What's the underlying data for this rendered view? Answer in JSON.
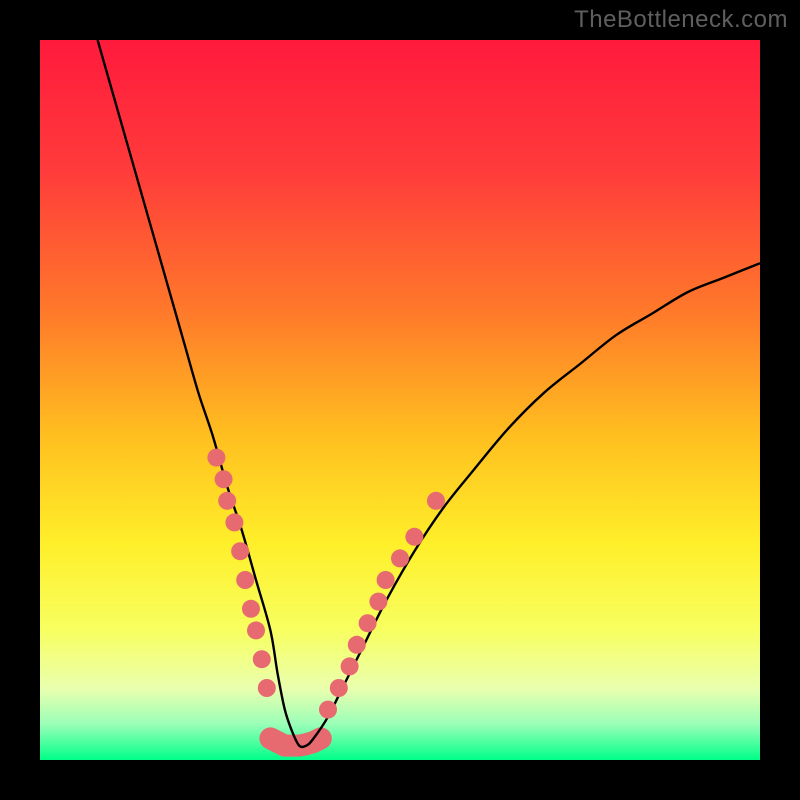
{
  "watermark": "TheBottleneck.com",
  "chart_data": {
    "type": "line",
    "title": "",
    "xlabel": "",
    "ylabel": "",
    "xlim": [
      0,
      100
    ],
    "ylim": [
      0,
      100
    ],
    "gradient_stops": [
      {
        "offset": 0,
        "color": "#ff1a3c"
      },
      {
        "offset": 18,
        "color": "#ff3b3b"
      },
      {
        "offset": 38,
        "color": "#ff7a2a"
      },
      {
        "offset": 55,
        "color": "#ffbf1f"
      },
      {
        "offset": 70,
        "color": "#ffef2a"
      },
      {
        "offset": 82,
        "color": "#f7ff60"
      },
      {
        "offset": 90,
        "color": "#eaffae"
      },
      {
        "offset": 95,
        "color": "#9bffb8"
      },
      {
        "offset": 100,
        "color": "#00ff88"
      }
    ],
    "series": [
      {
        "name": "bottleneck-curve",
        "color": "#000000",
        "x": [
          8,
          10,
          12,
          14,
          16,
          18,
          20,
          22,
          24,
          26,
          28,
          30,
          32,
          33,
          34,
          35,
          36,
          37,
          38,
          40,
          42,
          45,
          48,
          52,
          56,
          60,
          65,
          70,
          75,
          80,
          85,
          90,
          95,
          100
        ],
        "y": [
          100,
          93,
          86,
          79,
          72,
          65,
          58,
          51,
          45,
          38,
          32,
          25,
          18,
          12,
          7,
          4,
          2,
          2,
          3,
          6,
          10,
          16,
          22,
          29,
          35,
          40,
          46,
          51,
          55,
          59,
          62,
          65,
          67,
          69
        ]
      }
    ],
    "markers": {
      "color": "#e66a6f",
      "left_cluster": {
        "x": [
          24.5,
          25.5,
          26.0,
          27.0,
          27.8,
          28.5,
          29.3,
          30.0,
          30.8,
          31.5
        ],
        "y": [
          42,
          39,
          36,
          33,
          29,
          25,
          21,
          18,
          14,
          10
        ]
      },
      "right_cluster": {
        "x": [
          40.0,
          41.5,
          43.0,
          44.0,
          45.5,
          47.0,
          48.0,
          50.0,
          52.0,
          55.0
        ],
        "y": [
          7,
          10,
          13,
          16,
          19,
          22,
          25,
          28,
          31,
          36
        ]
      },
      "bottom_band": {
        "x": [
          32.0,
          33.0,
          34.0,
          35.0,
          36.0,
          37.0,
          38.0,
          39.0
        ],
        "y": [
          3,
          2.5,
          2,
          2,
          2,
          2.2,
          2.5,
          3
        ]
      }
    }
  }
}
